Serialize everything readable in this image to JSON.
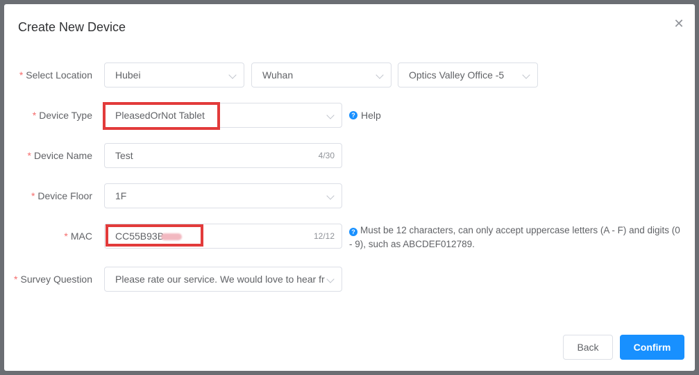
{
  "dialog": {
    "title": "Create New Device",
    "close_icon": "close-icon"
  },
  "form": {
    "required_mark": "*",
    "location": {
      "label": "Select Location",
      "province": "Hubei",
      "city": "Wuhan",
      "office": "Optics Valley Office -5"
    },
    "device_type": {
      "label": "Device Type",
      "value": "PleasedOrNot Tablet",
      "help_text": "Help"
    },
    "device_name": {
      "label": "Device Name",
      "value": "Test",
      "counter": "4/30"
    },
    "device_floor": {
      "label": "Device Floor",
      "value": "1F"
    },
    "mac": {
      "label": "MAC",
      "value": "CC55B93B",
      "counter": "12/12",
      "hint": "Must be 12 characters, can only accept uppercase letters (A - F) and digits (0 - 9), such as ABCDEF012789."
    },
    "survey_question": {
      "label": "Survey Question",
      "value": "Please rate our service. We would love to hear fr"
    }
  },
  "footer": {
    "back_label": "Back",
    "confirm_label": "Confirm"
  },
  "colors": {
    "primary": "#1890ff",
    "required": "#f56c6c",
    "highlight_box": "#e23b3b"
  }
}
